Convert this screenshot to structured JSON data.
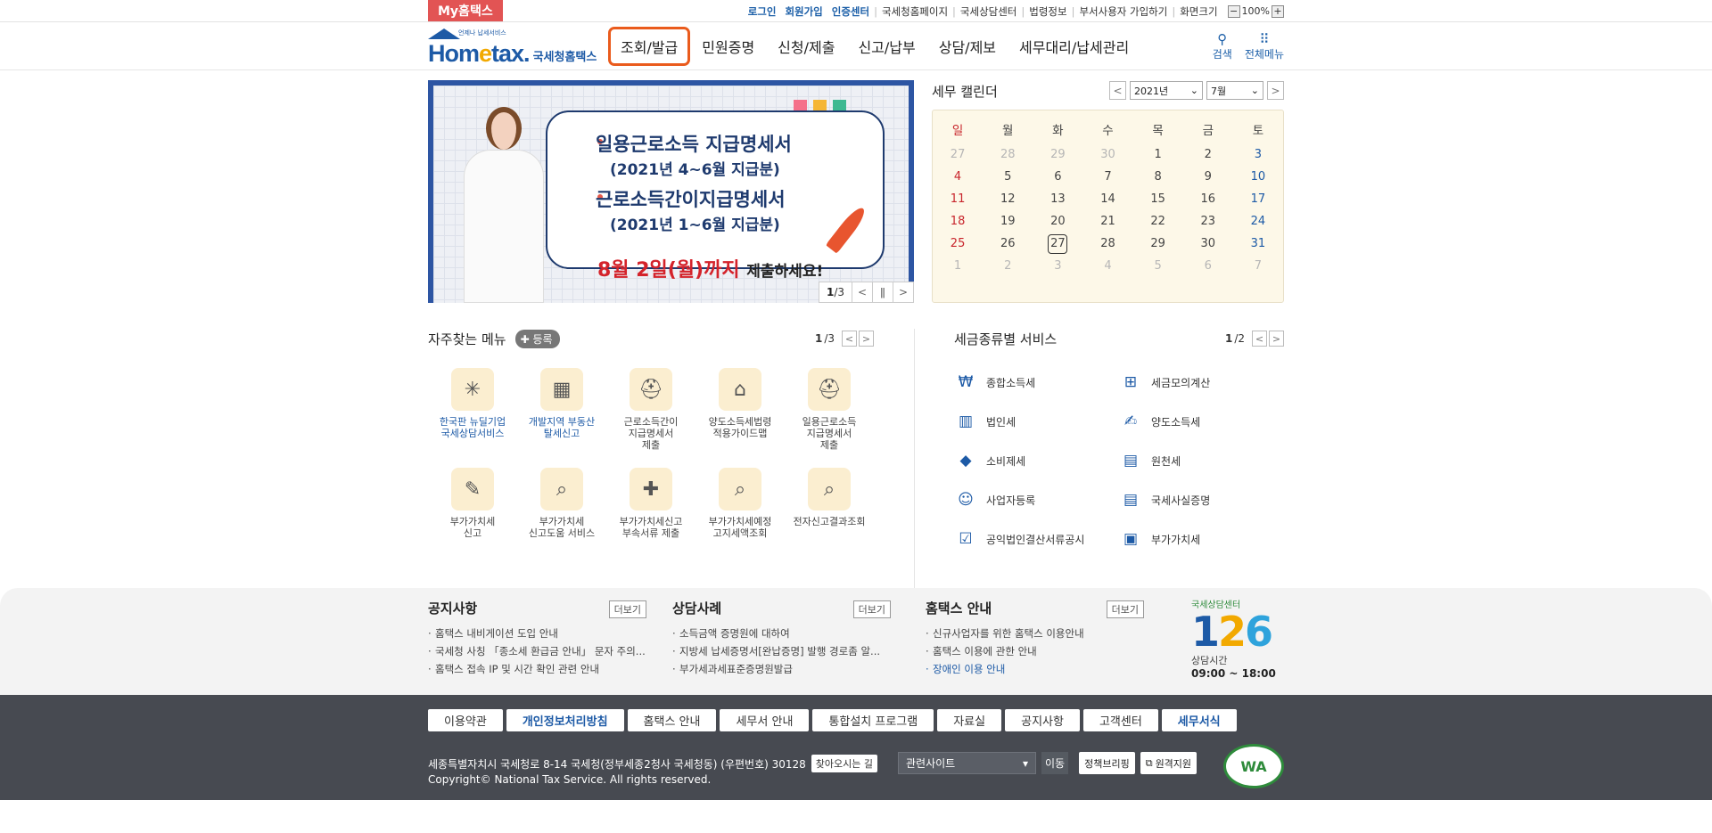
{
  "util": {
    "my_hometax": "My홈택스",
    "links": [
      "로그인",
      "회원가입",
      "인증센터",
      "국세청홈페이지",
      "국세상담센터",
      "법령정보",
      "부서사용자 가입하기",
      "화면크기"
    ],
    "zoom_minus": "−",
    "zoom_value": "100%",
    "zoom_plus": "+"
  },
  "header": {
    "logo_text_a": "Hom",
    "logo_text_e": "e",
    "logo_text_b": "tax.",
    "logo_small": "언제나 납세서비스",
    "logo_ko": "국세청홈택스",
    "gnb": [
      "조회/발급",
      "민원증명",
      "신청/제출",
      "신고/납부",
      "상담/제보",
      "세무대리/납세관리"
    ],
    "search_label": "검색",
    "allmenu_label": "전체메뉴"
  },
  "banner": {
    "line1": "일용근로소득 지급명세서",
    "line2": "(2021년 4~6월 지급분)",
    "line3": "근로소득간이지급명세서",
    "line4": "(2021년 1~6월 지급분)",
    "due_red": "8월 2일(월)까지",
    "due_black": "제출하세요!",
    "page_current": "1",
    "page_total": "/3",
    "colors": [
      "#f5708a",
      "#f5b635",
      "#3db991"
    ]
  },
  "calendar": {
    "title": "세무 캘린더",
    "year": "2021년",
    "month": "7월",
    "weekdays": [
      "일",
      "월",
      "화",
      "수",
      "목",
      "금",
      "토"
    ],
    "weeks": [
      [
        "27",
        "28",
        "29",
        "30",
        "1",
        "2",
        "3"
      ],
      [
        "4",
        "5",
        "6",
        "7",
        "8",
        "9",
        "10"
      ],
      [
        "11",
        "12",
        "13",
        "14",
        "15",
        "16",
        "17"
      ],
      [
        "18",
        "19",
        "20",
        "21",
        "22",
        "23",
        "24"
      ],
      [
        "25",
        "26",
        "27",
        "28",
        "29",
        "30",
        "31"
      ],
      [
        "1",
        "2",
        "3",
        "4",
        "5",
        "6",
        "7"
      ]
    ],
    "today": "27"
  },
  "favorites": {
    "title": "자주찾는 메뉴",
    "register": "등록",
    "page_current": "1",
    "page_total": "/3",
    "items": [
      {
        "label": "한국판 뉴딜기업\n국세상담서비스",
        "icon": "sparkle-icon",
        "glyph": "✳",
        "blue": true
      },
      {
        "label": "개발지역 부동산\n탈세신고",
        "icon": "building-icon",
        "glyph": "▦",
        "blue": true
      },
      {
        "label": "근로소득간이\n지급명세서\n제출",
        "icon": "helmet-icon",
        "glyph": "⛑",
        "blue": false
      },
      {
        "label": "양도소득세법령\n적용가이드맵",
        "icon": "house-icon",
        "glyph": "⌂",
        "blue": false
      },
      {
        "label": "일용근로소득\n지급명세서\n제출",
        "icon": "helmet-won-icon",
        "glyph": "⛑",
        "blue": false
      },
      {
        "label": "부가가치세\n신고",
        "icon": "vat-doc-icon",
        "glyph": "✎",
        "blue": false
      },
      {
        "label": "부가가치세\n신고도움 서비스",
        "icon": "doc-search-icon",
        "glyph": "⌕",
        "blue": false
      },
      {
        "label": "부가가치세신고\n부속서류 제출",
        "icon": "doc-add-icon",
        "glyph": "✚",
        "blue": false
      },
      {
        "label": "부가가치세예정\n고지세액조회",
        "icon": "doc-search2-icon",
        "glyph": "⌕",
        "blue": false
      },
      {
        "label": "전자신고결과조회",
        "icon": "doc-magnifier-icon",
        "glyph": "⌕",
        "blue": false
      }
    ]
  },
  "tax_service": {
    "title": "세금종류별 서비스",
    "page_current": "1",
    "page_total": "/2",
    "items": [
      {
        "label": "종합소득세",
        "icon": "money-bag-icon",
        "glyph": "₩"
      },
      {
        "label": "세금모의계산",
        "icon": "calculator-icon",
        "glyph": "⊞"
      },
      {
        "label": "법인세",
        "icon": "company-icon",
        "glyph": "▥"
      },
      {
        "label": "양도소득세",
        "icon": "contract-icon",
        "glyph": "✍"
      },
      {
        "label": "소비제세",
        "icon": "diamond-icon",
        "glyph": "◆"
      },
      {
        "label": "원천세",
        "icon": "receipt-icon",
        "glyph": "▤"
      },
      {
        "label": "사업자등록",
        "icon": "person-icon",
        "glyph": "☺"
      },
      {
        "label": "국세사실증명",
        "icon": "document-icon",
        "glyph": "▤"
      },
      {
        "label": "공익법인결산서류공시",
        "icon": "clipboard-icon",
        "glyph": "☑"
      },
      {
        "label": "부가가치세",
        "icon": "vat-icon",
        "glyph": "▣"
      }
    ]
  },
  "notice": {
    "more": "더보기",
    "cols": [
      {
        "title": "공지사항",
        "items": [
          "홈택스 내비게이션 도입 안내",
          "국세청 사칭 「종소세 환급금 안내」 문자 주의...",
          "홈택스 접속 IP 및 시간 확인 관련 안내"
        ]
      },
      {
        "title": "상담사례",
        "items": [
          "소득금액 증명원에 대하여",
          "지방세 납세증명서[완납증명] 발행 경로좀 알...",
          "부가세과세표준증명원발급"
        ]
      },
      {
        "title": "홈택스 안내",
        "items": [
          "신규사업자를 위한 홈택스 이용안내",
          "홈택스 이용에 관한 안내",
          "장애인 이용 안내"
        ]
      }
    ],
    "center_top": "국세상담센터",
    "center_num_1": "1",
    "center_num_2": "2",
    "center_num_3": "6",
    "center_time_label": "상담시간",
    "center_time": "09:00 ~ 18:00"
  },
  "footer": {
    "menu": [
      "이용약관",
      "개인정보처리방침",
      "홈택스 안내",
      "세무서 안내",
      "통합설치 프로그램",
      "자료실",
      "공지사항",
      "고객센터",
      "세무서식"
    ],
    "address": "세종특별자치시 국세청로 8-14 국세청(정부세종2청사 국세청동) (우편번호) 30128",
    "find_way": "찾아오시는 길",
    "copyright": "Copyright© National Tax Service. All rights reserved.",
    "related_site": "관련사이트",
    "go": "이동",
    "policy_brief": "정책브리핑",
    "remote_support": "원격지원",
    "wa_mark": "WA"
  }
}
